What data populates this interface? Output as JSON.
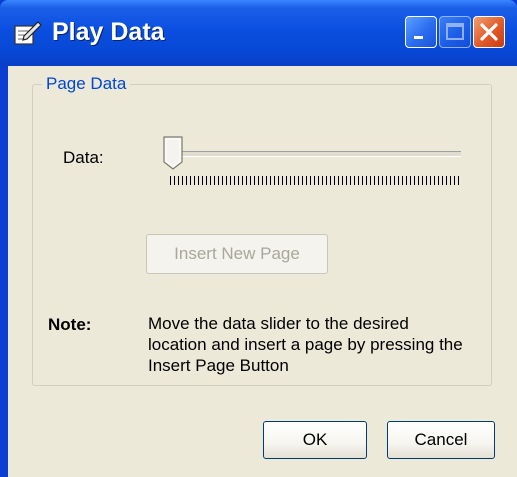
{
  "window": {
    "title": "Play Data",
    "icon": "pencil-note-icon"
  },
  "group": {
    "legend": "Page Data"
  },
  "slider": {
    "label": "Data:",
    "value": 0
  },
  "insert_button": {
    "label": "Insert New Page",
    "enabled": false
  },
  "note": {
    "label": "Note:",
    "text": "Move the data slider to the desired location and insert a page by pressing the Insert Page Button"
  },
  "buttons": {
    "ok": "OK",
    "cancel": "Cancel"
  },
  "colors": {
    "titlebar": "#0a4fe0",
    "client": "#ece9d8",
    "legend": "#0046d5",
    "close": "#e05a2a"
  }
}
